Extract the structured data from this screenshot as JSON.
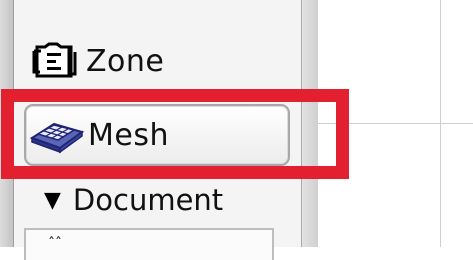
{
  "panel": {
    "items": [
      {
        "label": "Zone",
        "icon": "zone-icon"
      },
      {
        "label": "Mesh",
        "icon": "mesh-icon"
      }
    ],
    "section": {
      "label": "Document",
      "icon": "caret-down-icon"
    },
    "list_stub": "ˆˆ"
  },
  "colors": {
    "highlight": "#e3202f",
    "panel_bg": "#f4f4f4",
    "canvas_bg": "#ffffff"
  }
}
